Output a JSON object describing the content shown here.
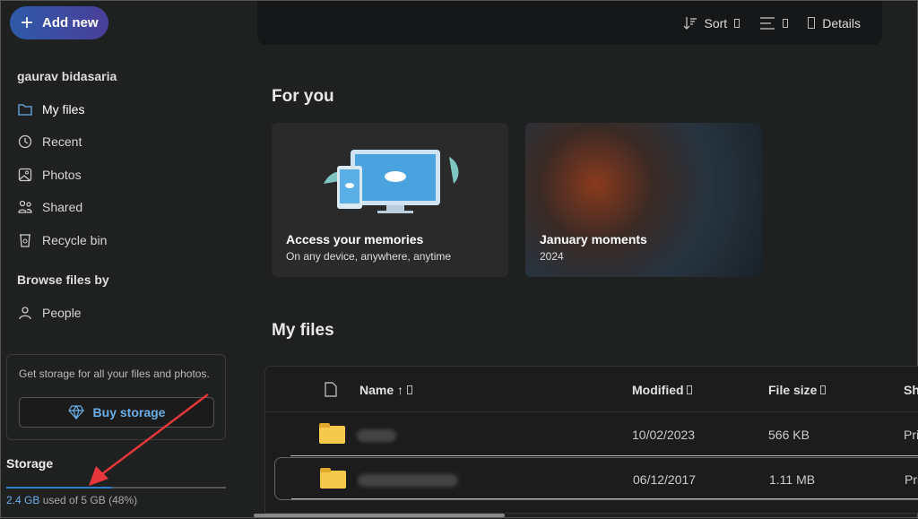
{
  "sidebar": {
    "add_new": "Add new",
    "user": "gaurav bidasaria",
    "nav": [
      {
        "label": "My files",
        "icon": "folder-icon"
      },
      {
        "label": "Recent",
        "icon": "history-icon"
      },
      {
        "label": "Photos",
        "icon": "image-icon"
      },
      {
        "label": "Shared",
        "icon": "people-icon"
      },
      {
        "label": "Recycle bin",
        "icon": "recycle-bin-icon"
      }
    ],
    "browse_heading": "Browse files by",
    "browse": [
      {
        "label": "People",
        "icon": "person-icon"
      }
    ],
    "promo_text": "Get storage for all your files and photos.",
    "buy_storage": "Buy storage",
    "storage_heading": "Storage",
    "storage_used": "2.4 GB",
    "storage_rest": " used of 5 GB (48%)",
    "storage_percent": 48
  },
  "toolbar": {
    "sort": "Sort",
    "details": "Details"
  },
  "for_you": {
    "heading": "For you",
    "cards": [
      {
        "title": "Access your memories",
        "subtitle": "On any device, anywhere, anytime"
      },
      {
        "title": "January moments",
        "subtitle": "2024"
      }
    ]
  },
  "my_files": {
    "heading": "My files",
    "columns": {
      "name": "Name ↑",
      "modified": "Modified",
      "size": "File size",
      "sharing": "Sharing"
    },
    "rows": [
      {
        "modified": "10/02/2023",
        "size": "566 KB",
        "sharing": "Private"
      },
      {
        "modified": "06/12/2017",
        "size": "1.11 MB",
        "sharing": "Private"
      }
    ]
  },
  "colors": {
    "accent": "#6aaee8",
    "folder": "#f5c94c"
  }
}
